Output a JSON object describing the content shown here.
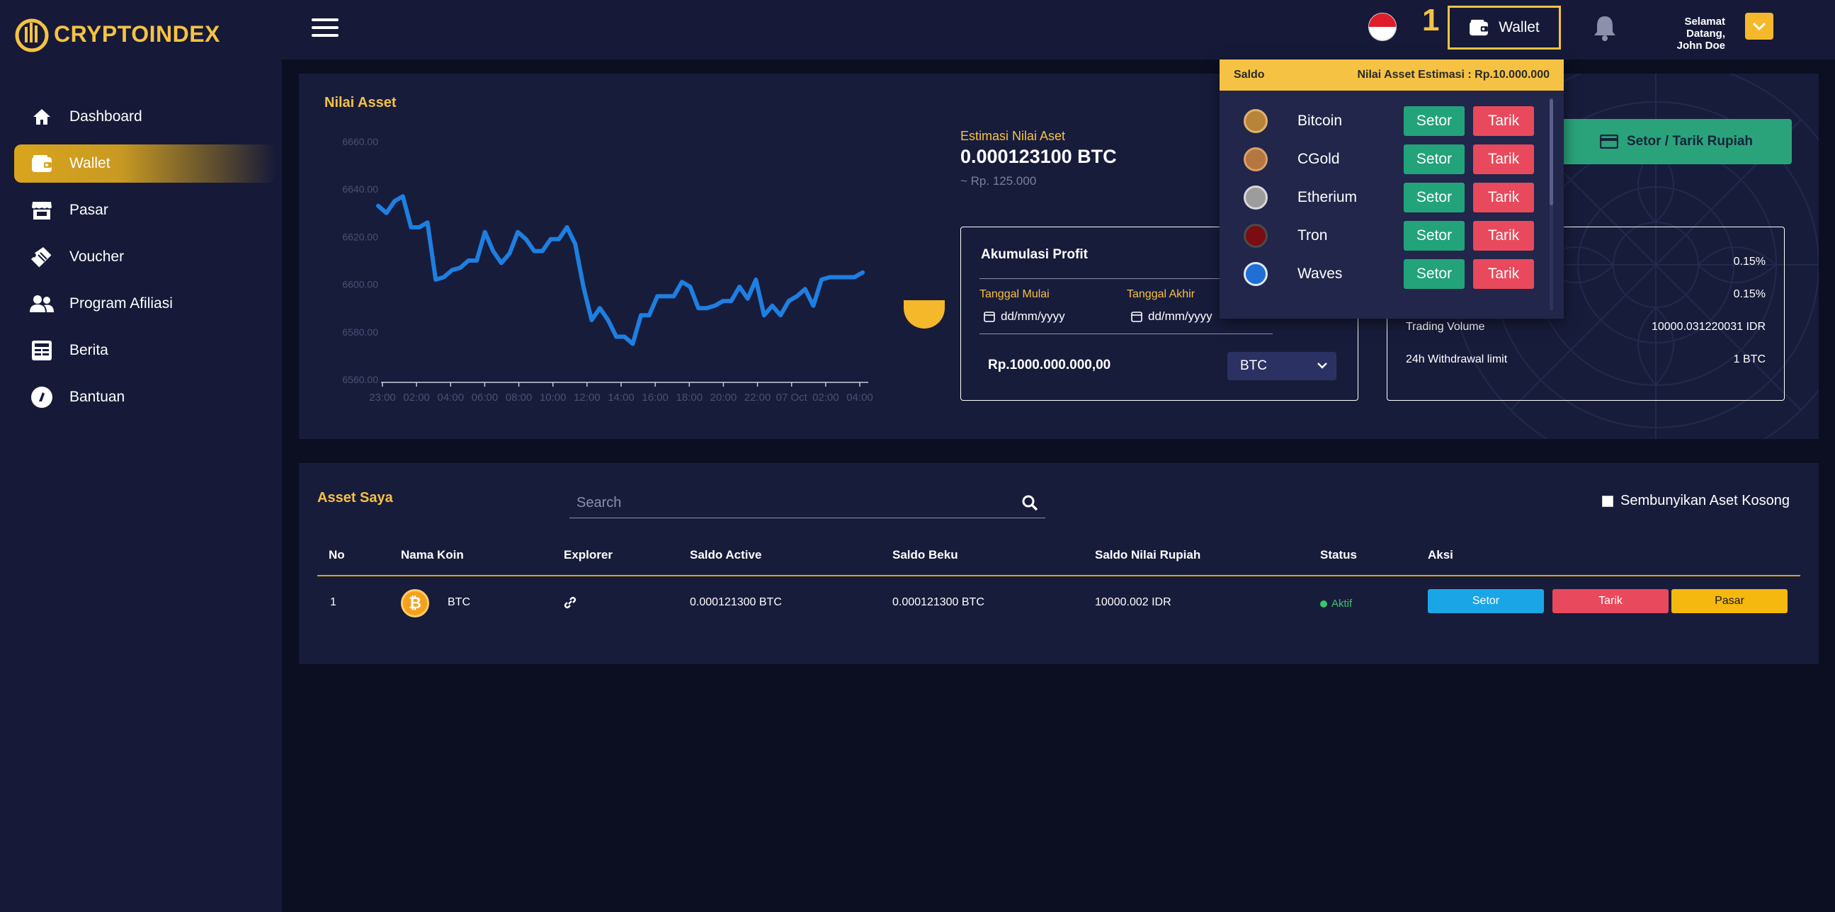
{
  "brand": {
    "name": "CRYPTOINDEX"
  },
  "sidebar": {
    "items": [
      {
        "label": "Dashboard",
        "icon": "home-icon"
      },
      {
        "label": "Wallet",
        "icon": "wallet-icon",
        "active": true
      },
      {
        "label": "Pasar",
        "icon": "store-icon"
      },
      {
        "label": "Voucher",
        "icon": "ticket-icon"
      },
      {
        "label": "Program Afiliasi",
        "icon": "users-icon"
      },
      {
        "label": "Berita",
        "icon": "newspaper-icon"
      },
      {
        "label": "Bantuan",
        "icon": "help-icon"
      }
    ]
  },
  "topbar": {
    "step_number": "1",
    "wallet_label": "Wallet",
    "welcome_line1": "Selamat Datang,",
    "welcome_line2": "John Doe"
  },
  "wallet_dropdown": {
    "header_left": "Saldo",
    "header_right": "Nilai Asset Estimasi : Rp.10.000.000",
    "coins": [
      {
        "name": "Bitcoin",
        "setor": "Setor",
        "tarik": "Tarik",
        "color": "#b8843a"
      },
      {
        "name": "CGold",
        "setor": "Setor",
        "tarik": "Tarik",
        "color": "#b5773f"
      },
      {
        "name": "Etherium",
        "setor": "Setor",
        "tarik": "Tarik",
        "color": "#9c9c9c"
      },
      {
        "name": "Tron",
        "setor": "Setor",
        "tarik": "Tarik",
        "color": "#7a0d12"
      },
      {
        "name": "Waves",
        "setor": "Setor",
        "tarik": "Tarik",
        "color": "#1f6fd6"
      }
    ]
  },
  "nilai_asset": {
    "title": "Nilai Asset",
    "estimasi_label": "Estimasi Nilai Aset",
    "estimasi_value": "0.000123100 BTC",
    "estimasi_sub": "~ Rp. 125.000"
  },
  "chart_data": {
    "type": "line",
    "title": "",
    "xlabel": "",
    "ylabel": "",
    "y_ticks": [
      "6560.00",
      "6580.00",
      "6600.00",
      "6620.00",
      "6640.00",
      "6660.00"
    ],
    "x_ticks": [
      "23:00",
      "02:00",
      "04:00",
      "06:00",
      "08:00",
      "10:00",
      "12:00",
      "14:00",
      "16:00",
      "18:00",
      "20:00",
      "22:00",
      "07 Oct",
      "02:00",
      "04:00"
    ],
    "ylim": [
      6560,
      6660
    ],
    "series": [
      {
        "color": "#1e7fe0",
        "values": [
          6633,
          6630,
          6635,
          6637,
          6624,
          6624,
          6626,
          6602,
          6603,
          6606,
          6607,
          6610,
          6610,
          6622,
          6614,
          6609,
          6613,
          6622,
          6619,
          6614,
          6614,
          6619,
          6619,
          6624,
          6617,
          6599,
          6585,
          6590,
          6585,
          6578,
          6578,
          6575,
          6587,
          6587,
          6595,
          6595,
          6595,
          6601,
          6599,
          6590,
          6590,
          6591,
          6593,
          6593,
          6599,
          6594,
          6602,
          6587,
          6591,
          6587,
          6593,
          6595,
          6598,
          6591,
          6602,
          6603,
          6603,
          6603,
          6603,
          6605
        ]
      }
    ]
  },
  "profit": {
    "title": "Akumulasi Profit",
    "start_label": "Tanggal Mulai",
    "end_label": "Tanggal Akhir",
    "date_placeholder": "dd/mm/yyyy",
    "amount": "Rp.1000.000.000,00",
    "coin_selected": "BTC"
  },
  "setor_tarik_rupiah": "Setor / Tarik Rupiah",
  "info": {
    "rows": [
      {
        "label": "",
        "value": "0.15%"
      },
      {
        "label": "",
        "value": "0.15%"
      },
      {
        "label": "Trading Volume",
        "value": "10000.031220031 IDR"
      },
      {
        "label": "24h Withdrawal limit",
        "value": "1 BTC"
      }
    ]
  },
  "asset_saya": {
    "title": "Asset Saya",
    "search_placeholder": "Search",
    "hide_empty_label": "Sembunyikan Aset Kosong",
    "columns": [
      "No",
      "Nama Koin",
      "Explorer",
      "Saldo Active",
      "Saldo Beku",
      "Saldo Nilai Rupiah",
      "Status",
      "Aksi"
    ],
    "rows": [
      {
        "no": "1",
        "coin": "BTC",
        "saldo_active": "0.000121300 BTC",
        "saldo_beku": "0.000121300 BTC",
        "saldo_rupiah": "10000.002 IDR",
        "status": "Aktif",
        "actions": {
          "setor": "Setor",
          "tarik": "Tarik",
          "pasar": "Pasar"
        }
      }
    ]
  },
  "colors": {
    "accent": "#f5c243",
    "setor": "#22a37a",
    "tarik": "#e9495c",
    "blue": "#1aa6e6",
    "sidebar_bg": "#161a38",
    "page_bg": "#0c0e22"
  }
}
